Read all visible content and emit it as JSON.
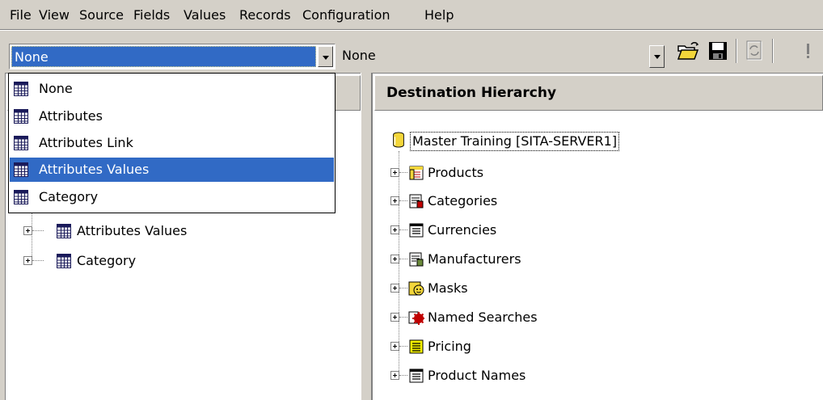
{
  "menu": [
    "File",
    "View",
    "Source",
    "Fields",
    "Values",
    "Records",
    "Configuration",
    "Help"
  ],
  "toolbar": {
    "source_combo_value": "None",
    "dest_combo_value": "None",
    "icons": [
      "open-folder-icon",
      "save-icon",
      "refresh-icon",
      "exclamation-icon"
    ]
  },
  "dropdown": {
    "items": [
      "None",
      "Attributes",
      "Attributes Link",
      "Attributes Values",
      "Category"
    ],
    "selected": "Attributes Values"
  },
  "source_tree": {
    "items": [
      "Attributes Values",
      "Category"
    ]
  },
  "destination": {
    "header": "Destination Hierarchy",
    "root": "Master Training [SITA-SERVER1]",
    "items": [
      {
        "label": "Products",
        "icon": "products-table-icon"
      },
      {
        "label": "Categories",
        "icon": "categories-table-icon"
      },
      {
        "label": "Currencies",
        "icon": "currencies-table-icon"
      },
      {
        "label": "Manufacturers",
        "icon": "manufacturers-table-icon"
      },
      {
        "label": "Masks",
        "icon": "masks-icon"
      },
      {
        "label": "Named Searches",
        "icon": "named-searches-icon"
      },
      {
        "label": "Pricing",
        "icon": "pricing-table-icon"
      },
      {
        "label": "Product Names",
        "icon": "product-names-table-icon"
      }
    ]
  },
  "colors": {
    "selection": "#316ac5",
    "chrome": "#d4d0c8"
  }
}
